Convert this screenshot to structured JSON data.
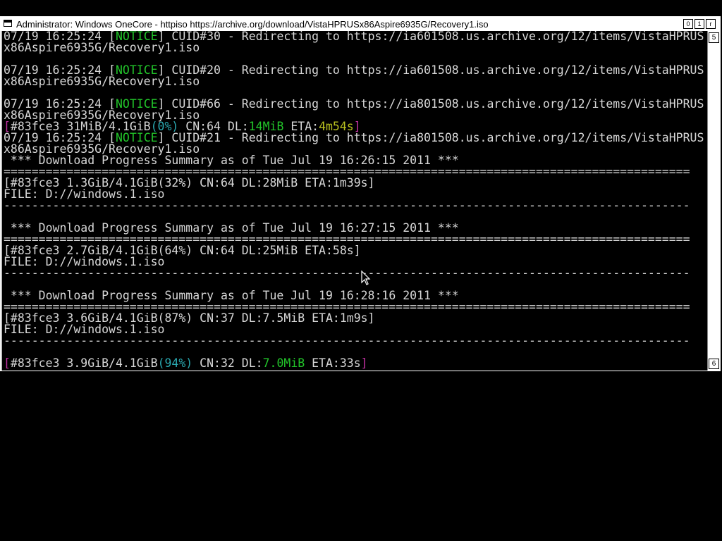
{
  "window": {
    "title": "Administrator:  Windows OneCore - httpiso  https://archive.org/download/VistaHPRUSx86Aspire6935G/Recovery1.iso",
    "btn_min": "0",
    "btn_max": "1",
    "btn_close": "r"
  },
  "scrollbar": {
    "up": "5",
    "down": "6"
  },
  "console": {
    "l01_a": "07/19 16:25:24 [",
    "l01_b": "NOTICE",
    "l01_c": "] CUID#30 - Redirecting to https://ia601508.us.archive.org/12/items/VistaHPRUS",
    "l02": "x86Aspire6935G/Recovery1.iso",
    "l04_a": "07/19 16:25:24 [",
    "l04_b": "NOTICE",
    "l04_c": "] CUID#20 - Redirecting to https://ia601508.us.archive.org/12/items/VistaHPRUS",
    "l05": "x86Aspire6935G/Recovery1.iso",
    "l07_a": "07/19 16:25:24 [",
    "l07_b": "NOTICE",
    "l07_c": "] CUID#66 - Redirecting to https://ia801508.us.archive.org/12/items/VistaHPRUS",
    "l08": "x86Aspire6935G/Recovery1.iso",
    "l09_a": "[",
    "l09_b": "#83fce3 31MiB/4.1GiB",
    "l09_c": "(0%)",
    "l09_d": " CN:64 DL:",
    "l09_e": "14MiB",
    "l09_f": " ETA:",
    "l09_g": "4m54s",
    "l09_h": "]",
    "l10_a": "07/19 16:25:24 [",
    "l10_b": "NOTICE",
    "l10_c": "] CUID#21 - Redirecting to https://ia801508.us.archive.org/12/items/VistaHPRUS",
    "l11": "x86Aspire6935G/Recovery1.iso",
    "l12": " *** Download Progress Summary as of Tue Jul 19 16:26:15 2011 ***",
    "l13": "==================================================================================================",
    "l14": "[#83fce3 1.3GiB/4.1GiB(32%) CN:64 DL:28MiB ETA:1m39s]",
    "l15": "FILE: D://windows.1.iso",
    "l16": "--------------------------------------------------------------------------------------------------",
    "l18": " *** Download Progress Summary as of Tue Jul 19 16:27:15 2011 ***",
    "l19": "==================================================================================================",
    "l20": "[#83fce3 2.7GiB/4.1GiB(64%) CN:64 DL:25MiB ETA:58s]",
    "l21": "FILE: D://windows.1.iso",
    "l22": "--------------------------------------------------------------------------------------------------",
    "l24": " *** Download Progress Summary as of Tue Jul 19 16:28:16 2011 ***",
    "l25": "==================================================================================================",
    "l26": "[#83fce3 3.6GiB/4.1GiB(87%) CN:37 DL:7.5MiB ETA:1m9s]",
    "l27": "FILE: D://windows.1.iso",
    "l28": "--------------------------------------------------------------------------------------------------",
    "l30_a": "[",
    "l30_b": "#83fce3 3.9GiB/4.1GiB",
    "l30_c": "(94%)",
    "l30_d": " CN:32 DL:",
    "l30_e": "7.0MiB",
    "l30_f": " ETA:33s",
    "l30_g": "]"
  },
  "colors": {
    "notice": "#22c52a",
    "bracket": "#c030a0",
    "percent": "#2aa8b0",
    "eta": "#b8c020",
    "text": "#d8d8d8",
    "background": "#000000"
  }
}
